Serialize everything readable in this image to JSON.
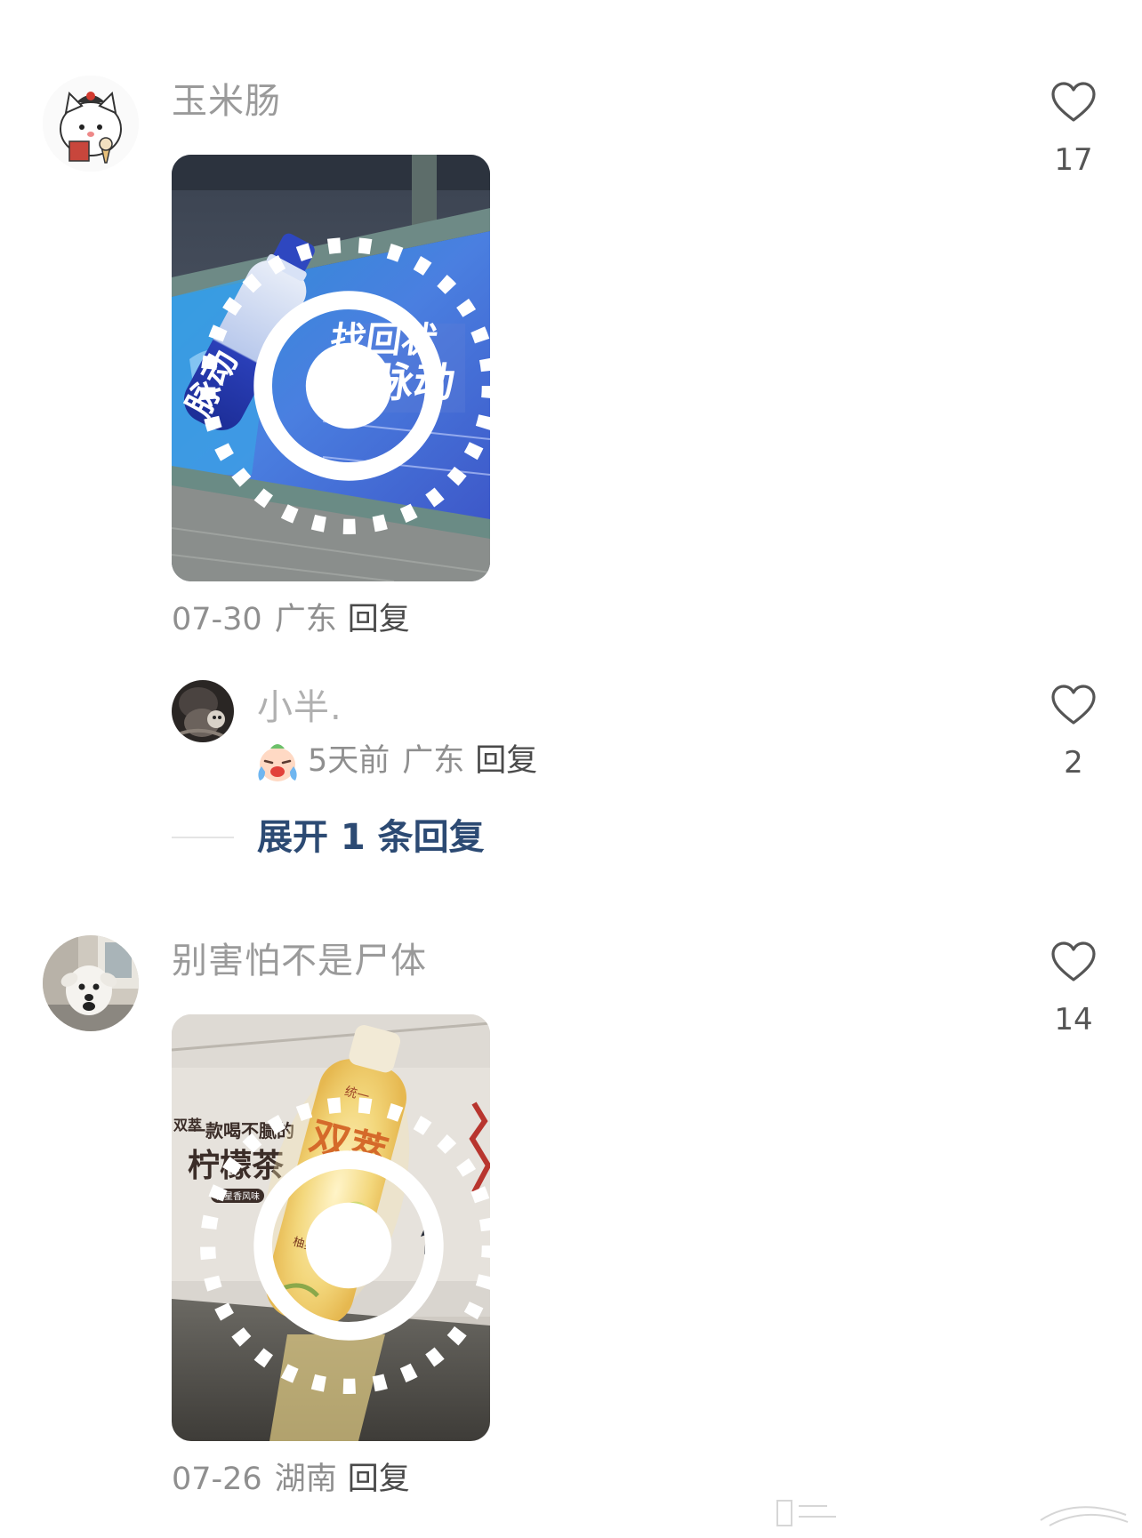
{
  "comments": [
    {
      "username": "玉米肠",
      "date": "07-30",
      "location": "广东",
      "reply_label": "回复",
      "likes": "17",
      "photo_text": {
        "slogan_line1": "找回状",
        "slogan_line2": "脉动",
        "bottle_label": "脉动"
      }
    },
    {
      "username": "别害怕不是尸体",
      "date": "07-26",
      "location": "湖南",
      "reply_label": "回复",
      "likes": "14",
      "photo_text": {
        "brand_small": "统一",
        "bottle_label": "双萃",
        "bottle_sub": "柚星香风味",
        "poster_line1": "一款喝不腻的",
        "poster_line2": "柠檬茶",
        "poster_badge": "柚星香风味",
        "side_text": "双萃"
      }
    }
  ],
  "sub_reply": {
    "username": "小半.",
    "time": "5天前",
    "location": "广东",
    "reply_label": "回复",
    "likes": "2",
    "emoji": "crying-laughing-face"
  },
  "expand_replies": {
    "label": "展开 1 条回复"
  },
  "icons": {
    "like": "heart-outline-icon",
    "live_photo": "live-photo-icon"
  },
  "colors": {
    "username": "#9a9a9a",
    "meta": "#8f8f8f",
    "expand_link": "#2c4a73"
  }
}
